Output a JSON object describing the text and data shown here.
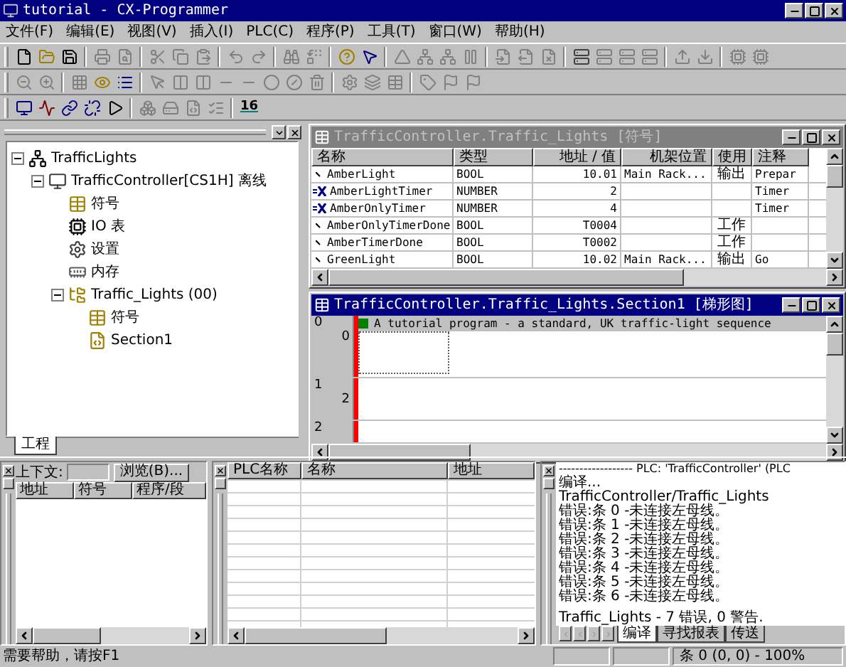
{
  "window": {
    "title": "tutorial - CX-Programmer"
  },
  "menu": [
    "文件(F)",
    "编辑(E)",
    "视图(V)",
    "插入(I)",
    "PLC(C)",
    "程序(P)",
    "工具(T)",
    "窗口(W)",
    "帮助(H)"
  ],
  "toolbar": {
    "word_display_button": "16"
  },
  "project": {
    "tree": [
      {
        "label": "TrafficLights",
        "kind": "project",
        "expanded": true,
        "children": [
          {
            "label": "TrafficController[CS1H] 离线",
            "kind": "plc",
            "expanded": true,
            "children": [
              {
                "label": "符号",
                "kind": "symbols"
              },
              {
                "label": "IO 表",
                "kind": "io"
              },
              {
                "label": "设置",
                "kind": "settings"
              },
              {
                "label": "内存",
                "kind": "memory"
              },
              {
                "label": "Traffic_Lights (00)",
                "kind": "program",
                "expanded": true,
                "children": [
                  {
                    "label": "符号",
                    "kind": "symbols"
                  },
                  {
                    "label": "Section1",
                    "kind": "section"
                  }
                ]
              }
            ]
          }
        ]
      }
    ],
    "tabs": [
      {
        "label": "工程",
        "selected": true
      }
    ]
  },
  "symbol_window": {
    "title": "TrafficController.Traffic_Lights [符号]",
    "active": false,
    "columns": [
      "名称",
      "类型",
      "地址 / 值",
      "机架位置",
      "使用",
      "注释"
    ],
    "rows": [
      {
        "kind": "bool",
        "name": "AmberLight",
        "type": "BOOL",
        "address": "10.01",
        "rack": "Main Rack...",
        "usage": "输出",
        "comment": "Prepar"
      },
      {
        "kind": "number",
        "name": "AmberLightTimer",
        "type": "NUMBER",
        "address": "2",
        "comment": "Timer"
      },
      {
        "kind": "number",
        "name": "AmberOnlyTimer",
        "type": "NUMBER",
        "address": "4",
        "comment": "Timer"
      },
      {
        "kind": "bool",
        "name": "AmberOnlyTimerDone",
        "type": "BOOL",
        "address": "T0004",
        "usage": "工作"
      },
      {
        "kind": "bool",
        "name": "AmberTimerDone",
        "type": "BOOL",
        "address": "T0002",
        "usage": "工作"
      },
      {
        "kind": "bool",
        "name": "GreenLight",
        "type": "BOOL",
        "address": "10.02",
        "rack": "Main Rack...",
        "usage": "输出",
        "comment": "Go"
      }
    ]
  },
  "ladder_window": {
    "title": "TrafficController.Traffic_Lights.Section1 [梯形图]",
    "active": true,
    "rungs": [
      {
        "number": "0",
        "step": "0",
        "comment": "A tutorial program - a standard, UK traffic-light sequence"
      },
      {
        "number": "1",
        "step": "2"
      },
      {
        "number": "2"
      }
    ]
  },
  "watch_panel": {
    "context_label": "上下文:",
    "browse_button": "浏览(B)...",
    "columns": [
      "地址",
      "符号",
      "程序/段"
    ]
  },
  "address_panel": {
    "columns": [
      "PLC名称",
      "名称",
      "地址"
    ]
  },
  "output_panel": {
    "lines": [
      "------------------ PLC: 'TrafficController' (PLC",
      "编译...",
      "TrafficController/Traffic_Lights",
      "错误:条 0 -未连接左母线。",
      "错误:条 1 -未连接左母线。",
      "错误:条 2 -未连接左母线。",
      "错误:条 3 -未连接左母线。",
      "错误:条 4 -未连接左母线。",
      "错误:条 5 -未连接左母线。",
      "错误:条 6 -未连接左母线。"
    ],
    "summary": "Traffic_Lights - 7 错误, 0 警告.",
    "tabs": [
      {
        "label": "编译",
        "selected": true
      },
      {
        "label": "寻找报表",
        "selected": false
      },
      {
        "label": "传送",
        "selected": false
      }
    ]
  },
  "status_bar": {
    "help": "需要帮助，请按F1",
    "position": "条 0 (0, 0) - 100%"
  }
}
